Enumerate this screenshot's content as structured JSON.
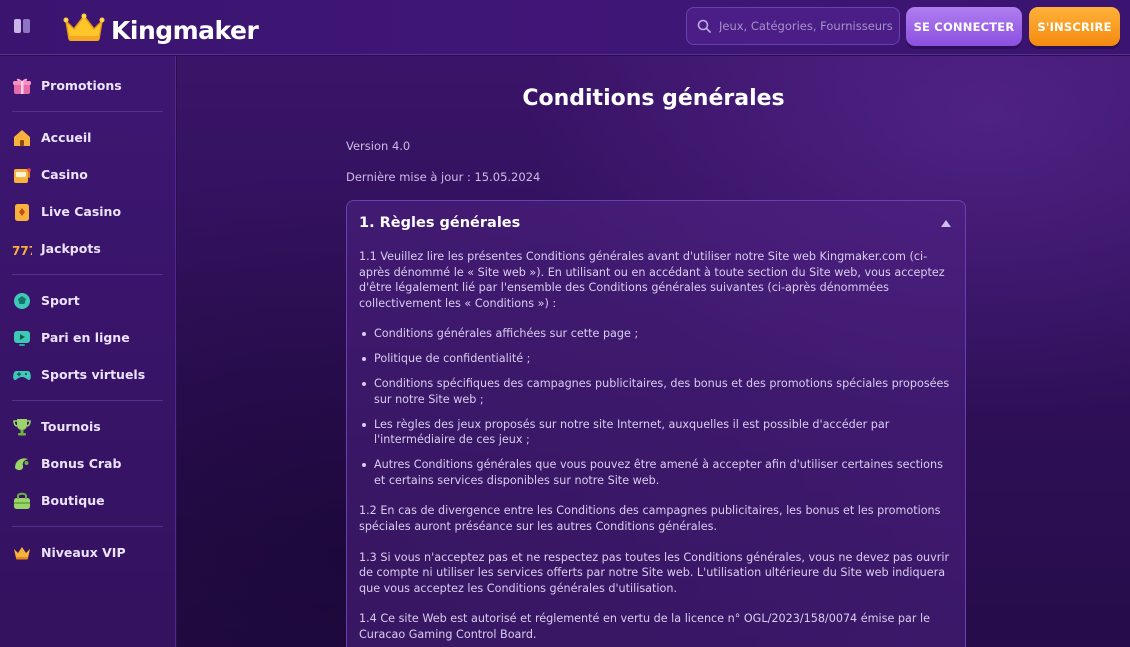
{
  "header": {
    "brand": "Kingmaker",
    "search_placeholder": "Jeux, Catégories, Fournisseurs",
    "login_label": "SE CONNECTER",
    "register_label": "S'INSCRIRE"
  },
  "sidebar": {
    "groups": [
      [
        {
          "label": "Promotions",
          "icon": "gift-icon"
        }
      ],
      [
        {
          "label": "Accueil",
          "icon": "home-icon"
        },
        {
          "label": "Casino",
          "icon": "slot-machine-icon"
        },
        {
          "label": "Live Casino",
          "icon": "card-icon"
        },
        {
          "label": "Jackpots",
          "icon": "jackpot-777-icon"
        }
      ],
      [
        {
          "label": "Sport",
          "icon": "ball-icon"
        },
        {
          "label": "Pari en ligne",
          "icon": "tv-icon"
        },
        {
          "label": "Sports virtuels",
          "icon": "gamepad-icon"
        }
      ],
      [
        {
          "label": "Tournois",
          "icon": "trophy-icon"
        },
        {
          "label": "Bonus Crab",
          "icon": "crab-icon"
        },
        {
          "label": "Boutique",
          "icon": "shop-bag-icon"
        }
      ],
      [
        {
          "label": "Niveaux VIP",
          "icon": "crown-icon"
        }
      ]
    ]
  },
  "page": {
    "title": "Conditions générales",
    "version": "Version 4.0",
    "updated": "Dernière mise à jour : 15.05.2024"
  },
  "section": {
    "title": "1. Règles générales",
    "p1": "1.1 Veuillez lire les présentes Conditions générales avant d'utiliser notre Site web Kingmaker.com (ci-après dénommé le « Site web »). En utilisant ou en accédant à toute section du Site web, vous acceptez d'être légalement lié par l'ensemble des Conditions générales suivantes (ci-après dénommées collectivement les « Conditions ») :",
    "bullets": [
      "Conditions générales affichées sur cette page ;",
      "Politique de confidentialité ;",
      "Conditions spécifiques des campagnes publicitaires, des bonus et des promotions spéciales proposées sur notre Site web ;",
      "Les règles des jeux proposés sur notre site Internet, auxquelles il est possible d'accéder par l'intermédiaire de ces jeux ;",
      "Autres Conditions générales que vous pouvez être amené à accepter afin d'utiliser certaines sections et certains services disponibles sur notre Site web."
    ],
    "p2": "1.2 En cas de divergence entre les Conditions des campagnes publicitaires, les bonus et les promotions spéciales auront préséance sur les autres Conditions générales.",
    "p3": "1.3 Si vous n'acceptez pas et ne respectez pas toutes les Conditions générales, vous ne devez pas ouvrir de compte ni utiliser les services offerts par notre Site web. L'utilisation ultérieure du Site web indiquera que vous acceptez les Conditions générales d'utilisation.",
    "p4": "1.4 Ce site Web est autorisé et réglementé en vertu de la licence n° OGL/2023/158/0074 émise par le Curacao Gaming Control Board."
  },
  "colors": {
    "accent_purple": "#8b4fe0",
    "accent_orange": "#f48a10",
    "background": "#2a0f4e"
  }
}
